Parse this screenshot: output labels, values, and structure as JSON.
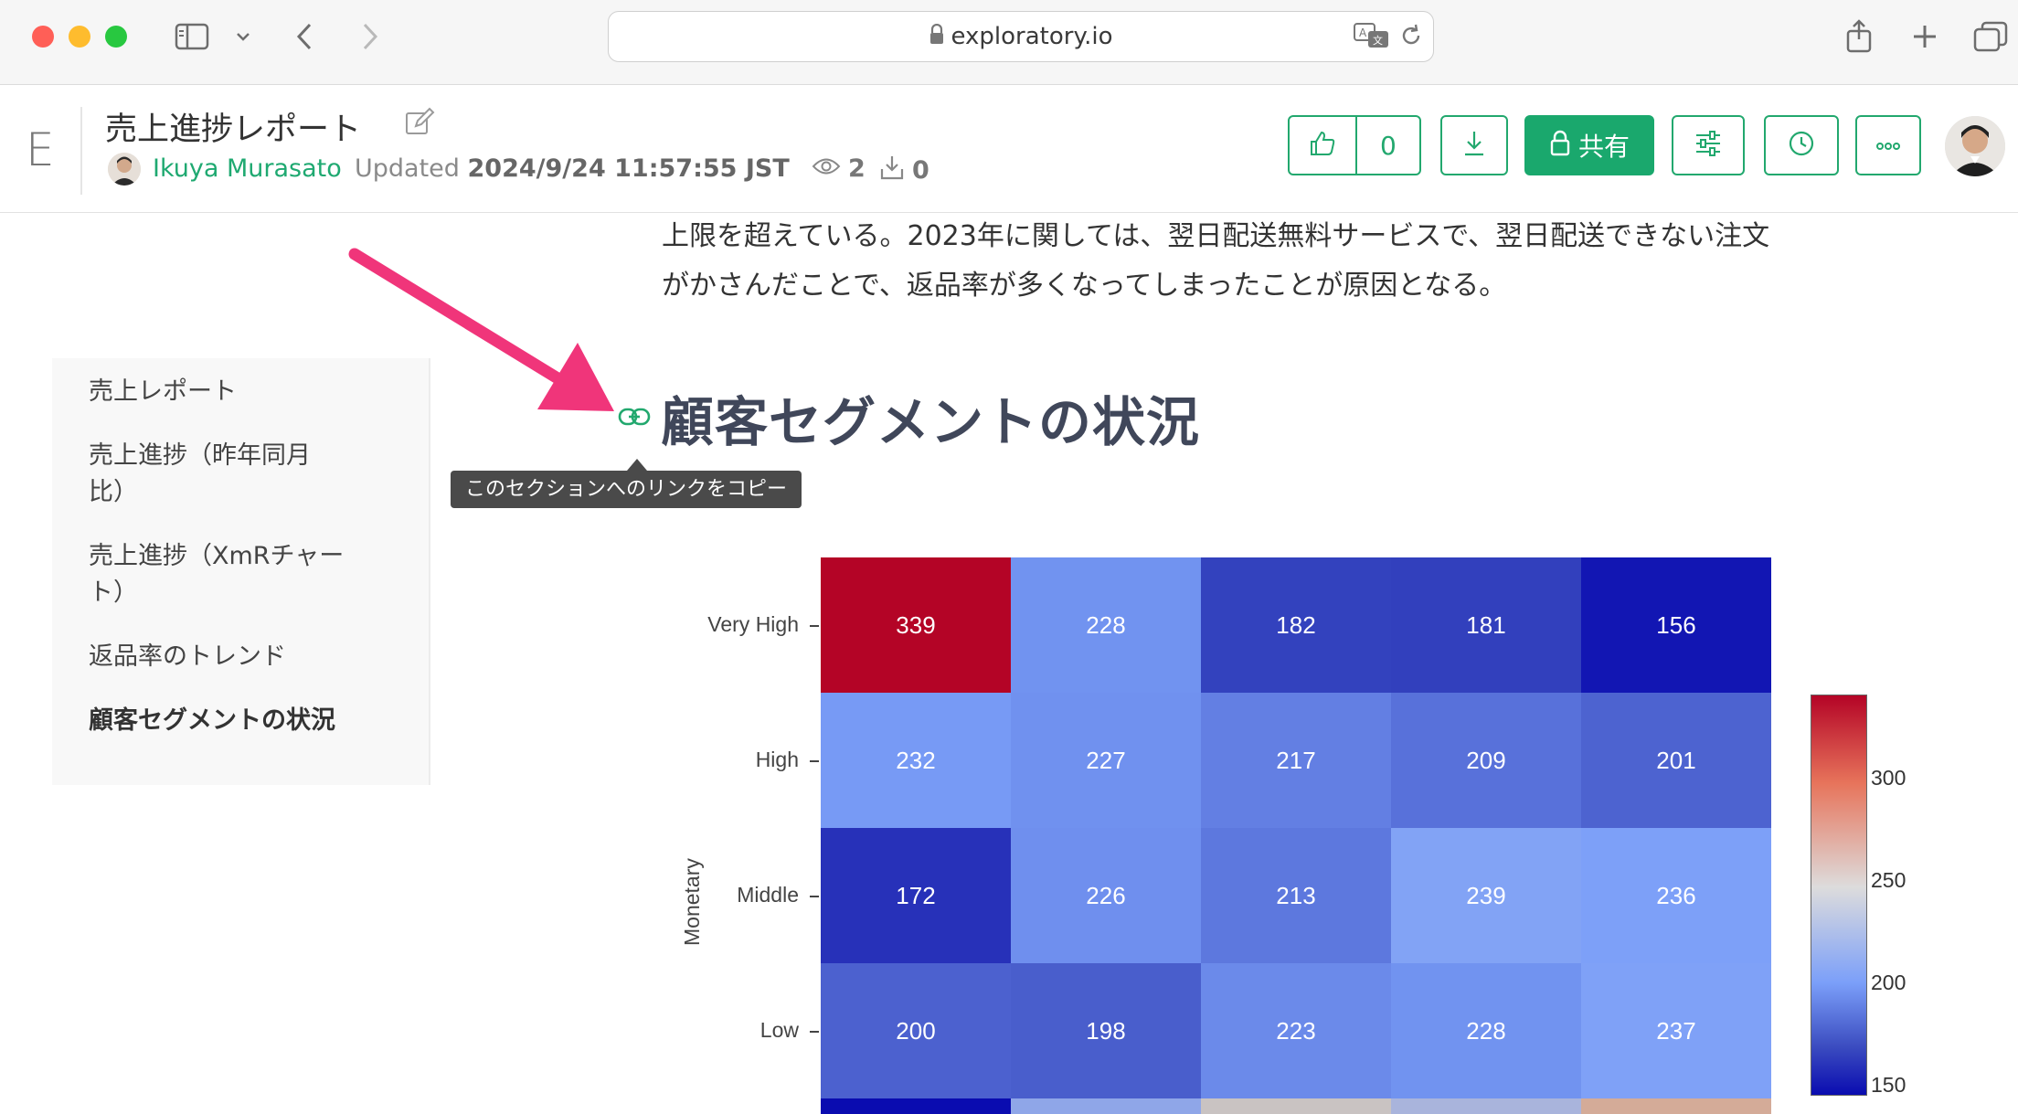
{
  "browser": {
    "url": "exploratory.io"
  },
  "header": {
    "logo": "E",
    "title": "売上進捗レポート",
    "author": "Ikuya Murasato",
    "updated_label": "Updated",
    "updated_value": "2024/9/24 11:57:55 JST",
    "views": "2",
    "downloads": "0",
    "likes": "0",
    "share_label": "共有"
  },
  "toc": {
    "items": [
      {
        "label": "売上レポート"
      },
      {
        "label": "売上進捗（昨年同月比）"
      },
      {
        "label": "売上進捗（XmRチャート）"
      },
      {
        "label": "返品率のトレンド"
      },
      {
        "label": "顧客セグメントの状況"
      }
    ]
  },
  "content": {
    "para_line1": "上限を超えている。2023年に関しては、翌日配送無料サービスで、翌日配送できない注文",
    "para_line2": "がかさんだことで、返品率が多くなってしまったことが原因となる。",
    "section_heading": "顧客セグメントの状況",
    "tooltip": "このセクションへのリンクをコピー"
  },
  "chart_data": {
    "type": "heatmap",
    "ylabel": "Monetary",
    "y_categories": [
      "Very High",
      "High",
      "Middle",
      "Low"
    ],
    "values": [
      [
        339,
        228,
        182,
        181,
        156
      ],
      [
        232,
        227,
        217,
        209,
        201
      ],
      [
        172,
        226,
        213,
        239,
        236
      ],
      [
        200,
        198,
        223,
        228,
        237
      ]
    ],
    "colorbar_ticks": [
      "300",
      "250",
      "200",
      "150"
    ],
    "colorscale": [
      "#0a0cb0",
      "#3b4cc0",
      "#7b9ff9",
      "#dddcdc",
      "#e7745b",
      "#b40426"
    ]
  }
}
